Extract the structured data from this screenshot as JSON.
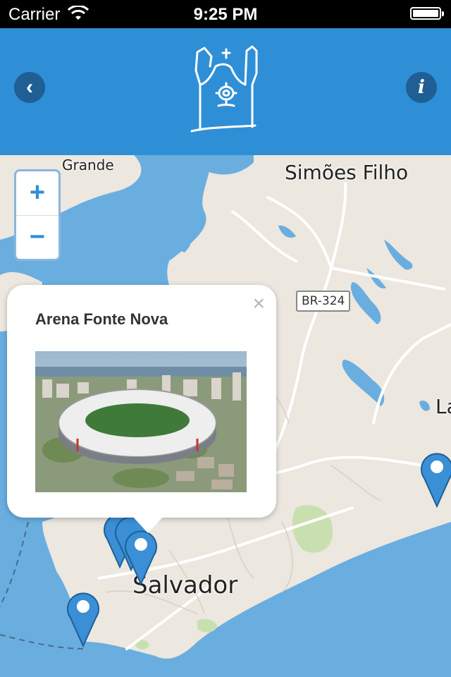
{
  "status_bar": {
    "carrier": "Carrier",
    "time": "9:25 PM"
  },
  "header": {
    "back_icon": "chevron-left-icon",
    "info_icon": "info-icon",
    "logo_icon": "church-logo"
  },
  "map": {
    "labels": {
      "grande": "Grande",
      "simoes_filho": "Simões Filho",
      "salvador": "Salvador",
      "la": "La"
    },
    "road_shield": "BR-324",
    "zoom": {
      "in": "+",
      "out": "−"
    },
    "colors": {
      "water": "#6aaee0",
      "land": "#ece7df",
      "roads": "#ffffff",
      "parks": "#c8e0b0",
      "pin": "#3a8fd6"
    }
  },
  "popup": {
    "title": "Arena Fonte Nova",
    "close": "×"
  }
}
